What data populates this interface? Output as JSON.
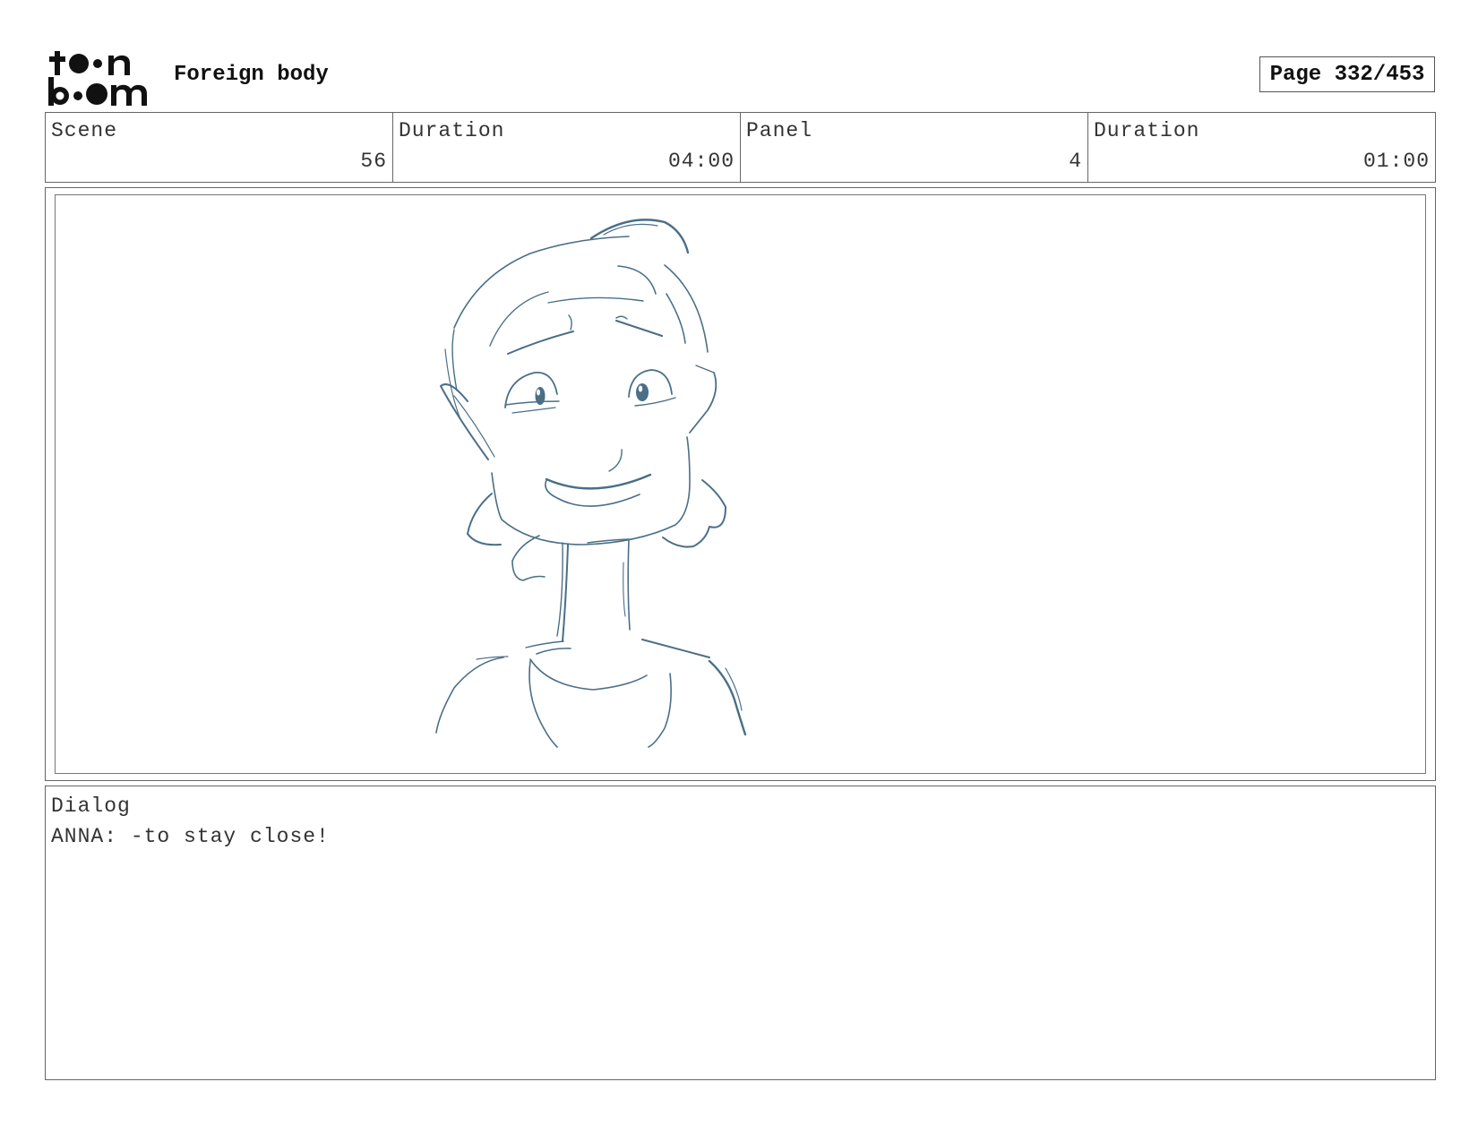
{
  "header": {
    "logo": {
      "brand": "toon boom",
      "icon": "toon-boom-logo"
    },
    "project_title": "Foreign body",
    "page_indicator": "Page 332/453"
  },
  "info_row": {
    "cells": [
      {
        "label": "Scene",
        "value": "56"
      },
      {
        "label": "Duration",
        "value": "04:00"
      },
      {
        "label": "Panel",
        "value": "4"
      },
      {
        "label": "Duration",
        "value": "01:00"
      }
    ]
  },
  "panel": {
    "drawing": "character-sketch",
    "stroke_color": "#4a6f87"
  },
  "dialog": {
    "label": "Dialog",
    "lines": [
      "ANNA: -to stay close!"
    ]
  }
}
